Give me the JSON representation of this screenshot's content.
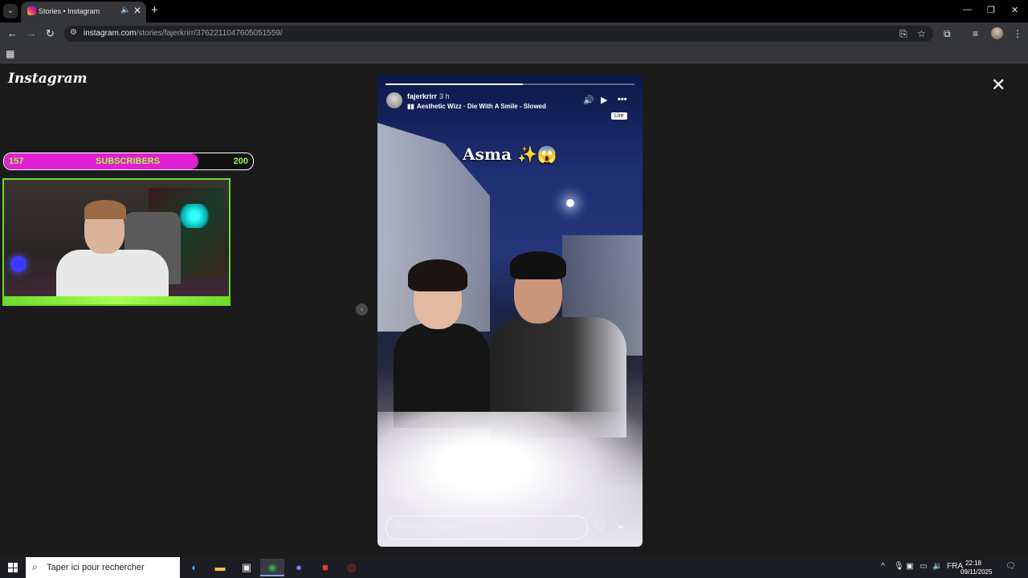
{
  "browser": {
    "tab_title": "Stories • Instagram",
    "tab_audio_icon": "speaker-icon",
    "url_host": "instagram.com",
    "url_path": "/stories/fajerkrirr/3762211047605051559/"
  },
  "page": {
    "logo": "Instagram"
  },
  "overlay": {
    "sub_min": "157",
    "sub_label": "SUBSCRIBERS",
    "sub_max": "200",
    "sub_progress_fraction": 0.78
  },
  "story": {
    "username": "fajerkrirr",
    "time": "3 h",
    "music": "Aesthetic Wizz · Die With A Smile - Slowed",
    "caption": "Asma ✨😱",
    "tooltip": "Lire",
    "reply_placeholder": "Répondre à fajerkrirr...",
    "progress_segments": 2,
    "progress_current_segment_fraction": 0.1
  },
  "taskbar": {
    "search_placeholder": "Taper ici pour rechercher",
    "language": "FRA",
    "time": "22:18",
    "date": "09/11/2025"
  }
}
